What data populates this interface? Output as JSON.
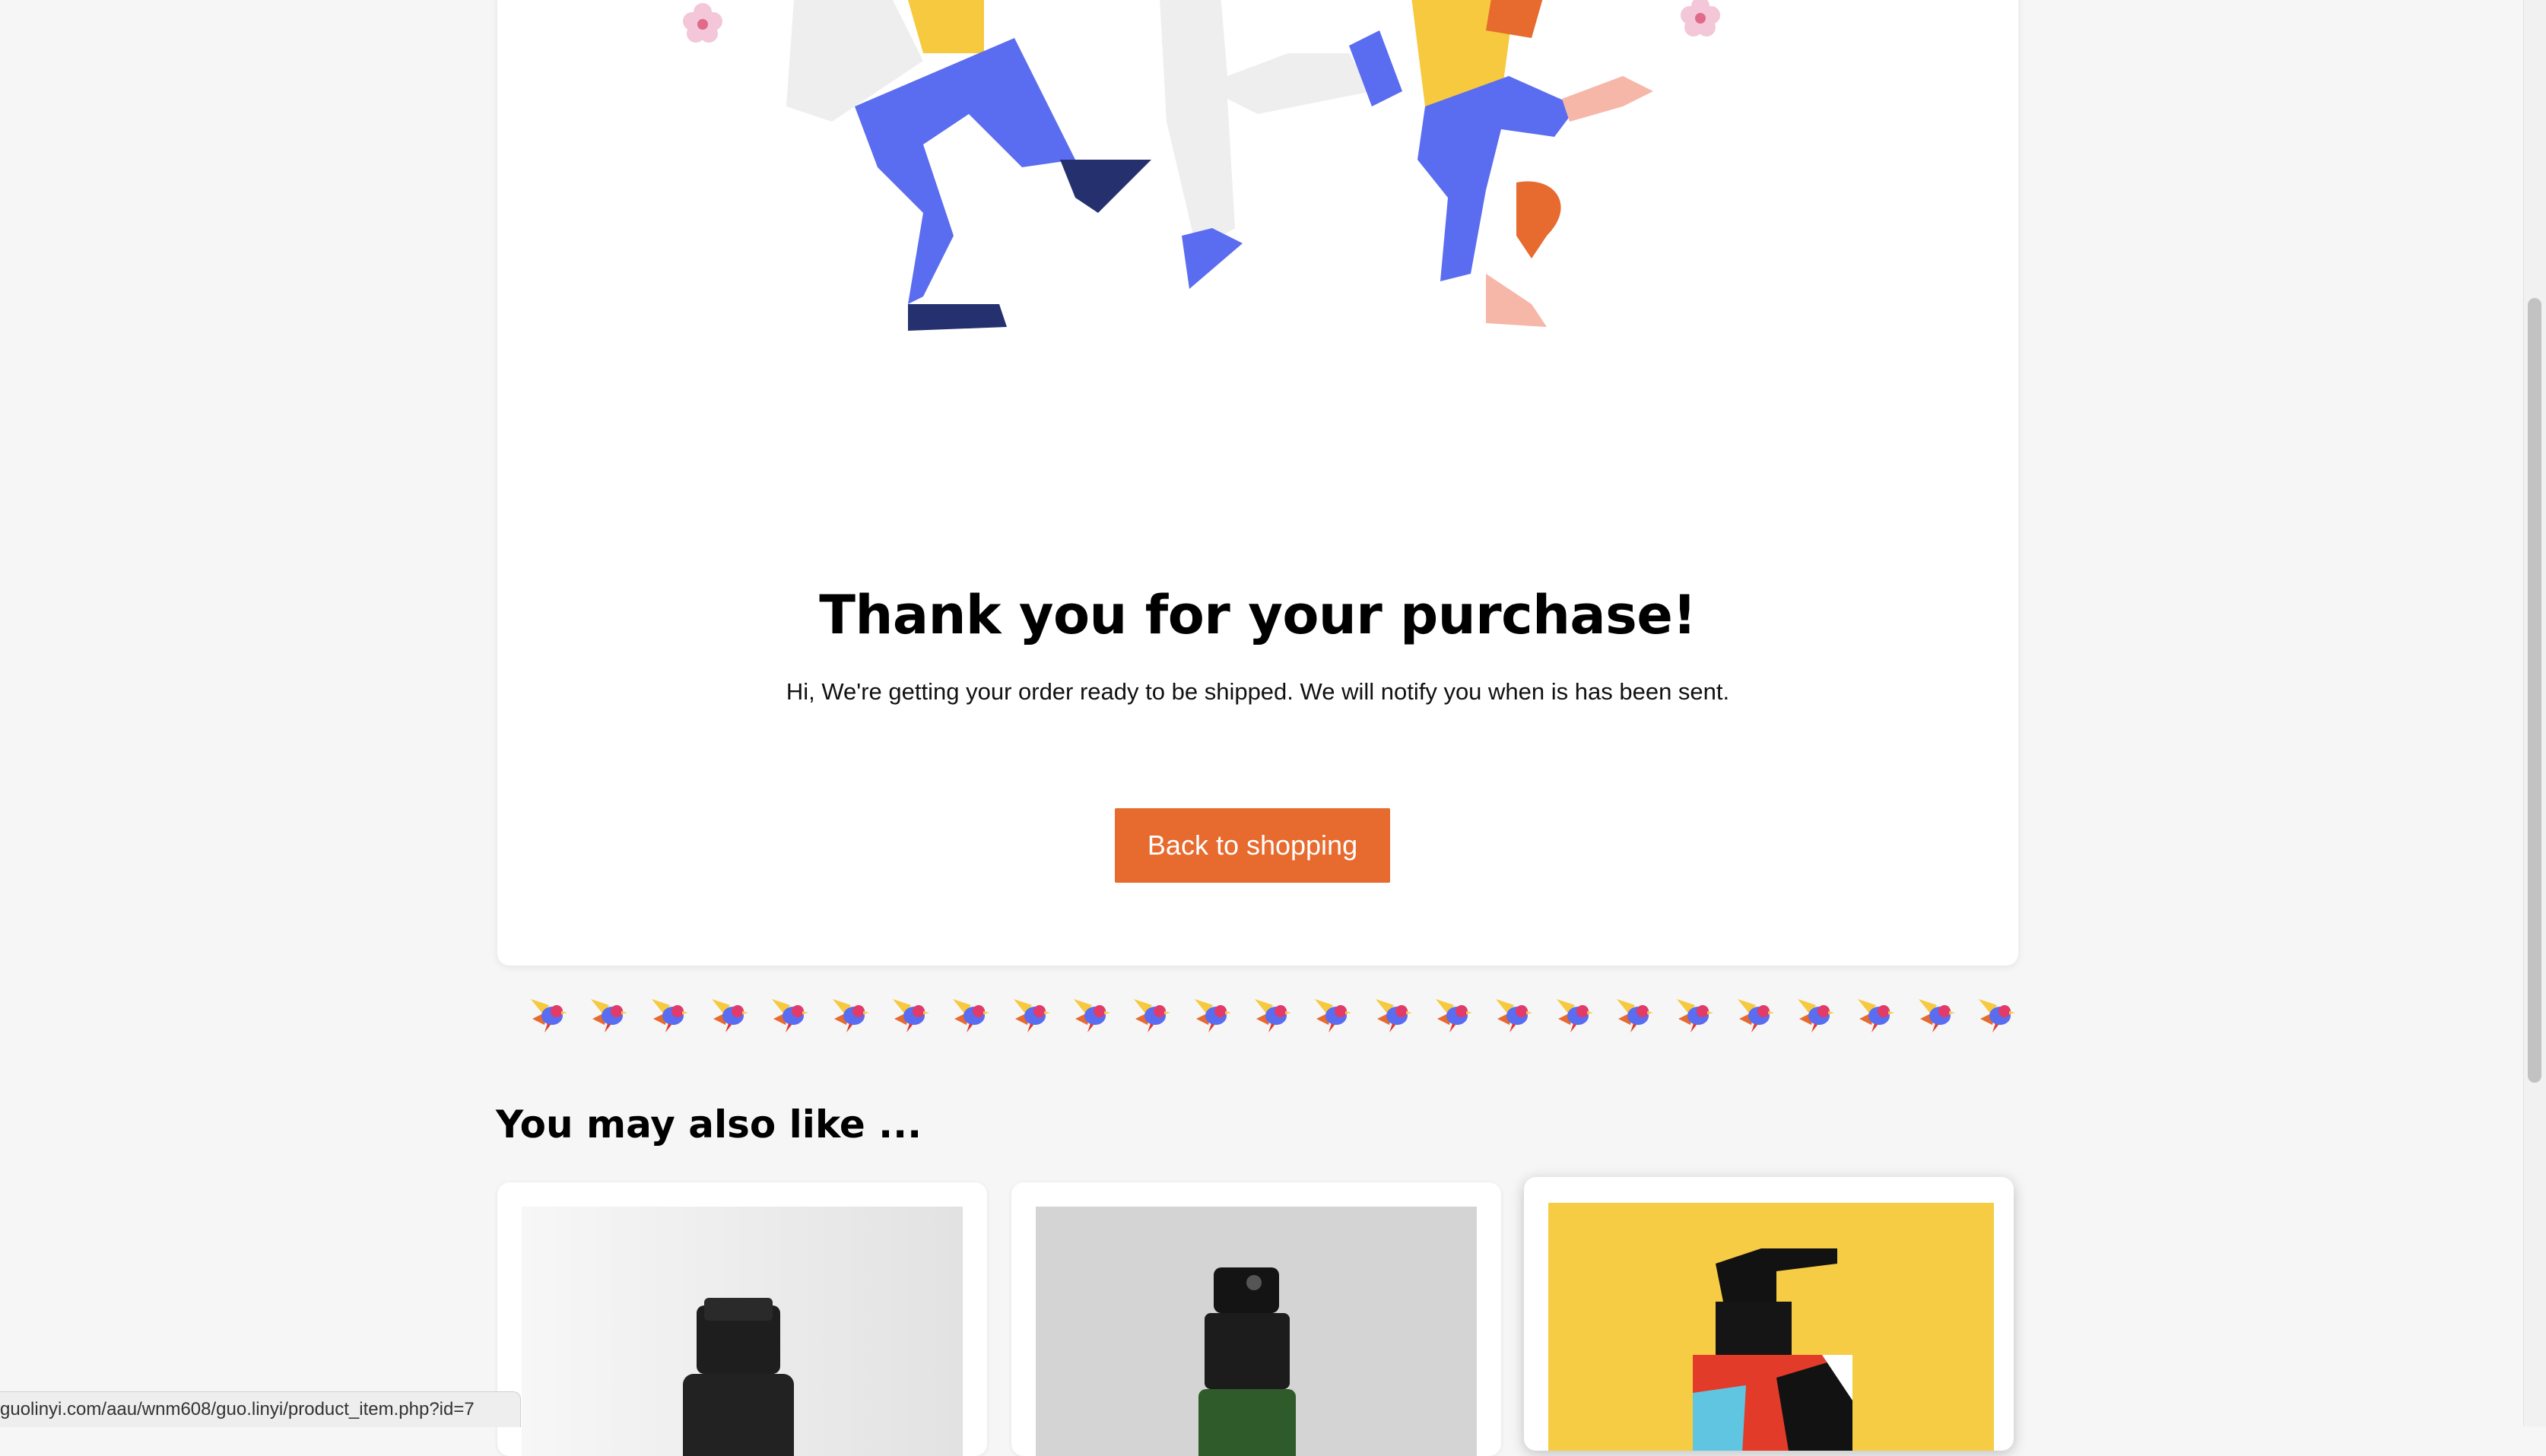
{
  "confirmation": {
    "title": "Thank you for your purchase!",
    "message": "Hi, We're getting your order ready to be shipped. We will notify you when is has been sent.",
    "button_label": "Back to shopping"
  },
  "recommendations": {
    "heading": "You may also like ...",
    "products": [
      {
        "image": "white-spray-bottle",
        "background": "#f1f1f1"
      },
      {
        "image": "green-spray-bottle",
        "background": "#d6d6d6"
      },
      {
        "image": "colorful-pump-bottle",
        "background": "#f6cc44"
      }
    ]
  },
  "status_bar": {
    "url": "guolinyi.com/aau/wnm608/guo.linyi/product_item.php?id=7"
  },
  "colors": {
    "accent": "#e76a2e",
    "page_background": "#f6f6f6",
    "card_background": "#ffffff"
  },
  "icons": {
    "bird": "bird-icon",
    "flower": "flower-icon"
  }
}
